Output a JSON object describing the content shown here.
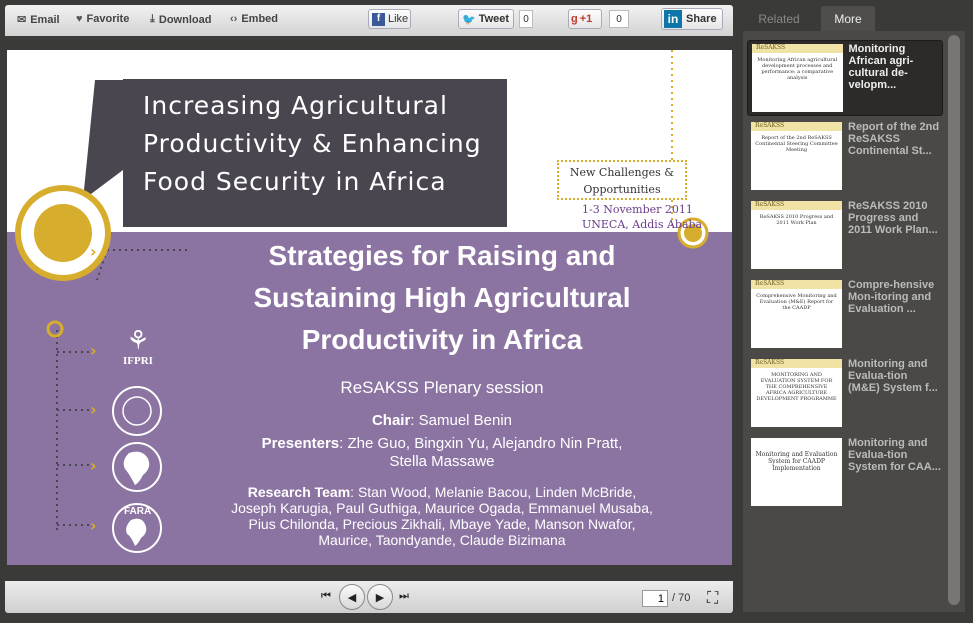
{
  "toolbar": {
    "email": "Email",
    "favorite": "Favorite",
    "download": "Download",
    "embed": "Embed",
    "like": "Like",
    "tweet": "Tweet",
    "tweet_count": "0",
    "gplus": "+1",
    "gplus_count": "0",
    "share": "Share"
  },
  "slide": {
    "header": [
      "Increasing Agricultural",
      "Productivity & Enhancing",
      "Food Security in Africa"
    ],
    "callout": [
      "New Challenges &",
      "Opportunities"
    ],
    "date": "1-3 November 2011",
    "venue": "UNECA, Addis Ababa",
    "title": [
      "Strategies for Raising and",
      "Sustaining High Agricultural",
      "Productivity in Africa"
    ],
    "session": "ReSAKSS  Plenary session",
    "chair_label": "Chair",
    "chair": ": Samuel Benin",
    "presenters_label": "Presenters",
    "presenters": [
      ": Zhe Guo, Bingxin Yu, Alejandro Nin Pratt,",
      "Stella Massawe"
    ],
    "team_label": "Research Team",
    "team": [
      ": Stan Wood, Melanie Bacou, Linden McBride,",
      "Joseph Karugia, Paul Guthiga, Maurice Ogada, Emmanuel Musaba,",
      "Pius Chilonda, Precious Zikhali, Mbaye Yade, Manson Nwafor,",
      "Maurice, Taondyande, Claude Bizimana"
    ],
    "logo_ifpri": "IFPRI",
    "logo_fara": "FARA"
  },
  "nav": {
    "page": "1",
    "total": "/ 70"
  },
  "tabs": {
    "related": "Related",
    "more": "More"
  },
  "related": [
    {
      "title": "Monitoring African agri-cultural de-velopm...",
      "thumb_header": "ReSAKSS",
      "thumb_body": "Monitoring African agricultural development processes and performance: a comparative analysis"
    },
    {
      "title": "Report of the 2nd ReSAKSS Continental St...",
      "thumb_header": "ReSAKSS",
      "thumb_body": "Report of the 2nd ReSAKSS Continental Steering Committee Meeting"
    },
    {
      "title": "ReSAKSS 2010 Progress and 2011 Work Plan...",
      "thumb_header": "ReSAKSS",
      "thumb_body": "ReSAKSS 2010 Progress and 2011 Work Plan"
    },
    {
      "title": "Compre-hensive Mon-itoring and Evaluation ...",
      "thumb_header": "ReSAKSS",
      "thumb_body": "Comprehensive Monitoring and Evaluation (M&E) Report for the CAADP"
    },
    {
      "title": "Monitoring and Evalua-tion (M&E) System f...",
      "thumb_header": "ReSAKSS",
      "thumb_body": "MONITORING AND EVALUATION SYSTEM FOR THE COMPREHENSIVE AFRICA AGRICULTURE DEVELOPMENT PROGRAMME"
    },
    {
      "title": "Monitoring and Evalua-tion System for CAA...",
      "thumb_header": "",
      "thumb_body": "Monitoring and Evaluation System for CAADP Implementation"
    }
  ],
  "colors": {
    "band": "#8c74a2",
    "gold": "#d6ad2c",
    "title_box": "#4a4650"
  }
}
